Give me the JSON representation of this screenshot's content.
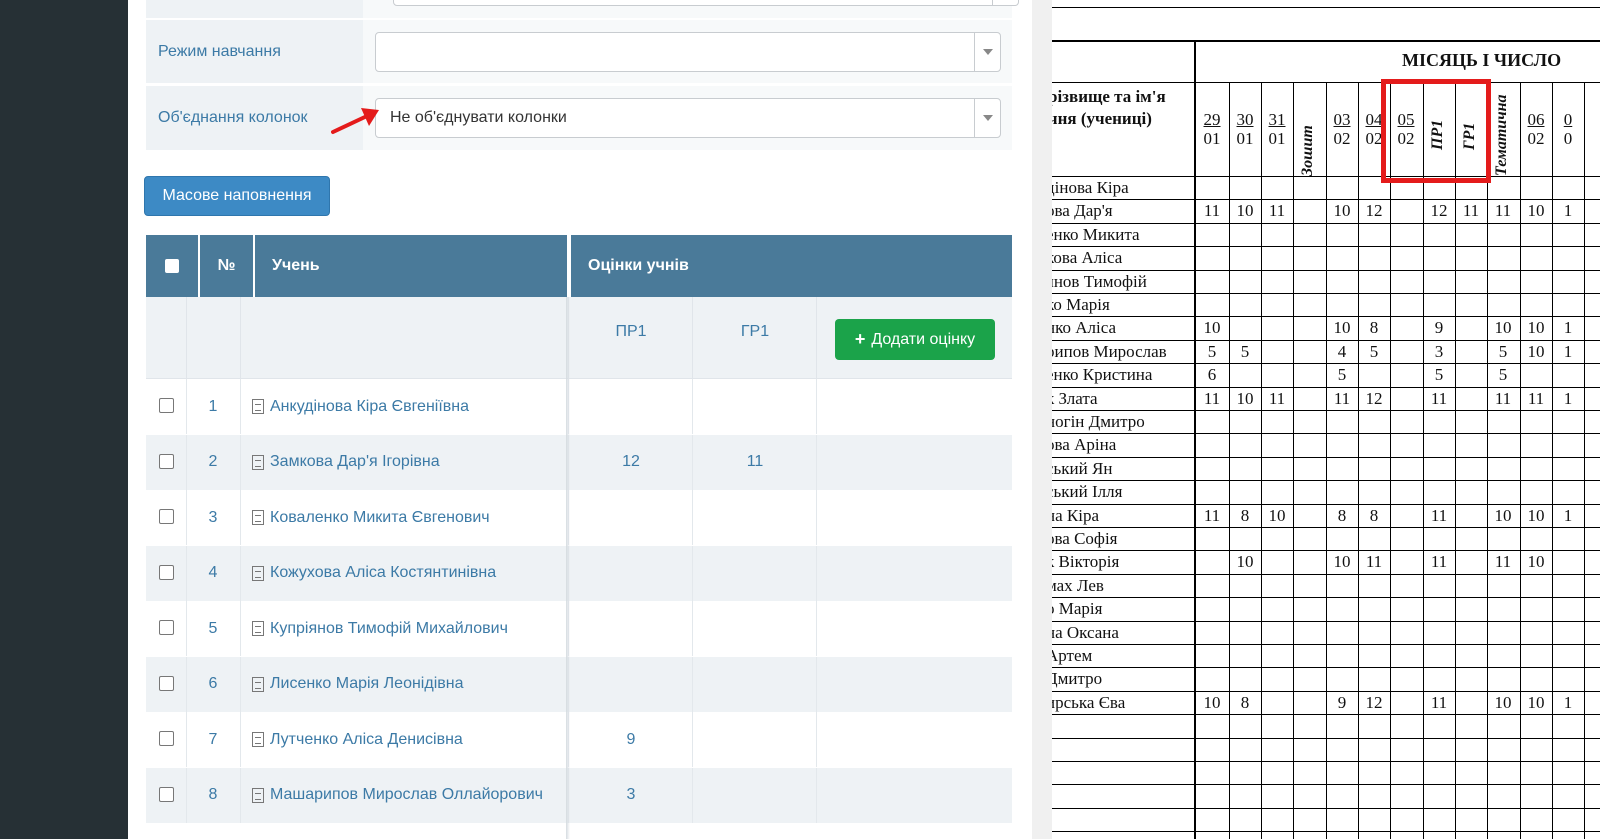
{
  "form": {
    "rows": [
      {
        "label": "Режим навчання",
        "value": ""
      },
      {
        "label": "Об'єднання колонок",
        "value": "Не об'єднувати колонки"
      }
    ],
    "mass_fill_label": "Масове наповнення"
  },
  "table": {
    "headers": {
      "num": "№",
      "student": "Учень",
      "grades": "Оцінки учнів"
    },
    "grade_columns": [
      "ПР1",
      "ГР1"
    ],
    "add_grade_label": "Додати оцінку",
    "rows": [
      {
        "n": "1",
        "name": "Анкудінова Кіра Євгеніївна",
        "pr1": "",
        "gr1": ""
      },
      {
        "n": "2",
        "name": "Замкова Дар'я Ігорівна",
        "pr1": "12",
        "gr1": "11"
      },
      {
        "n": "3",
        "name": "Коваленко Микита Євгенович",
        "pr1": "",
        "gr1": ""
      },
      {
        "n": "4",
        "name": "Кожухова Аліса Костянтинівна",
        "pr1": "",
        "gr1": ""
      },
      {
        "n": "5",
        "name": "Купріянов Тимофій Михайлович",
        "pr1": "",
        "gr1": ""
      },
      {
        "n": "6",
        "name": "Лисенко Марія Леонідівна",
        "pr1": "",
        "gr1": ""
      },
      {
        "n": "7",
        "name": "Лутченко Аліса Денисівна",
        "pr1": "9",
        "gr1": ""
      },
      {
        "n": "8",
        "name": "Машарипов Мирослав Оллайорович",
        "pr1": "3",
        "gr1": ""
      }
    ]
  },
  "journal": {
    "month_title": "МІСЯЦЬ І ЧИСЛО",
    "surname_header": "різвище та ім'я\nчня (учениці)",
    "columns": [
      {
        "type": "date",
        "d": "29",
        "m": "01"
      },
      {
        "type": "date",
        "d": "30",
        "m": "01"
      },
      {
        "type": "date",
        "d": "31",
        "m": "01"
      },
      {
        "type": "vert",
        "t": "Зошит"
      },
      {
        "type": "date",
        "d": "03",
        "m": "02"
      },
      {
        "type": "date",
        "d": "04",
        "m": "02"
      },
      {
        "type": "date",
        "d": "05",
        "m": "02"
      },
      {
        "type": "vert",
        "t": "ПР1"
      },
      {
        "type": "vert",
        "t": "ГР1"
      },
      {
        "type": "vert",
        "t": "Тематична"
      },
      {
        "type": "date",
        "d": "06",
        "m": "02"
      },
      {
        "type": "date",
        "d": "0",
        "m": "0"
      }
    ],
    "students": [
      {
        "name": "дінова Кіра",
        "g": [
          "",
          "",
          "",
          "",
          "",
          "",
          "",
          "",
          "",
          "",
          "",
          ""
        ]
      },
      {
        "name": "ова Дар'я",
        "g": [
          "11",
          "10",
          "11",
          "",
          "10",
          "12",
          "",
          "12",
          "11",
          "11",
          "10",
          "1"
        ]
      },
      {
        "name": "енко Микита",
        "g": [
          "",
          "",
          "",
          "",
          "",
          "",
          "",
          "",
          "",
          "",
          "",
          ""
        ]
      },
      {
        "name": "кова Аліса",
        "g": [
          "",
          "",
          "",
          "",
          "",
          "",
          "",
          "",
          "",
          "",
          "",
          ""
        ]
      },
      {
        "name": "янов Тимофій",
        "g": [
          "",
          "",
          "",
          "",
          "",
          "",
          "",
          "",
          "",
          "",
          "",
          ""
        ]
      },
      {
        "name": "ко Марія",
        "g": [
          "",
          "",
          "",
          "",
          "",
          "",
          "",
          "",
          "",
          "",
          "",
          ""
        ]
      },
      {
        "name": "нко Аліса",
        "g": [
          "10",
          "",
          "",
          "",
          "10",
          "8",
          "",
          "9",
          "",
          "10",
          "10",
          "1"
        ]
      },
      {
        "name": "рипов Мирослав",
        "g": [
          "5",
          "5",
          "",
          "",
          "4",
          "5",
          "",
          "3",
          "",
          "5",
          "10",
          "1"
        ]
      },
      {
        "name": "енко Кристина",
        "g": [
          "6",
          "",
          "",
          "",
          "5",
          "",
          "",
          "5",
          "",
          "5",
          "",
          ""
        ]
      },
      {
        "name": "к Злата",
        "g": [
          "11",
          "10",
          "11",
          "",
          "11",
          "12",
          "",
          "11",
          "",
          "11",
          "11",
          "1"
        ]
      },
      {
        "name": "ногін Дмитро",
        "g": [
          "",
          "",
          "",
          "",
          "",
          "",
          "",
          "",
          "",
          "",
          "",
          ""
        ]
      },
      {
        "name": "ова Аріна",
        "g": [
          "",
          "",
          "",
          "",
          "",
          "",
          "",
          "",
          "",
          "",
          "",
          ""
        ]
      },
      {
        "name": "ський Ян",
        "g": [
          "",
          "",
          "",
          "",
          "",
          "",
          "",
          "",
          "",
          "",
          "",
          ""
        ]
      },
      {
        "name": "ський Ілля",
        "g": [
          "",
          "",
          "",
          "",
          "",
          "",
          "",
          "",
          "",
          "",
          "",
          ""
        ]
      },
      {
        "name": "на Кіра",
        "g": [
          "11",
          "8",
          "10",
          "",
          "8",
          "8",
          "",
          "11",
          "",
          "10",
          "10",
          "1"
        ]
      },
      {
        "name": "ова Софія",
        "g": [
          "",
          "",
          "",
          "",
          "",
          "",
          "",
          "",
          "",
          "",
          "",
          ""
        ]
      },
      {
        "name": "к Вікторія",
        "g": [
          "",
          "10",
          "",
          "",
          "10",
          "11",
          "",
          "11",
          "",
          "11",
          "10",
          ""
        ]
      },
      {
        "name": "мах Лев",
        "g": [
          "",
          "",
          "",
          "",
          "",
          "",
          "",
          "",
          "",
          "",
          "",
          ""
        ]
      },
      {
        "name": "о Марія",
        "g": [
          "",
          "",
          "",
          "",
          "",
          "",
          "",
          "",
          "",
          "",
          "",
          ""
        ]
      },
      {
        "name": "на Оксана",
        "g": [
          "",
          "",
          "",
          "",
          "",
          "",
          "",
          "",
          "",
          "",
          "",
          ""
        ]
      },
      {
        "name": " Артем",
        "g": [
          "",
          "",
          "",
          "",
          "",
          "",
          "",
          "",
          "",
          "",
          "",
          ""
        ]
      },
      {
        "name": " Дмитро",
        "g": [
          "",
          "",
          "",
          "",
          "",
          "",
          "",
          "",
          "",
          "",
          "",
          ""
        ]
      },
      {
        "name": "ирська Єва",
        "g": [
          "10",
          "8",
          "",
          "",
          "9",
          "12",
          "",
          "11",
          "",
          "10",
          "10",
          "1"
        ]
      }
    ]
  },
  "colors": {
    "sidebar": "#263035",
    "header": "#4a7a99",
    "link": "#3c7aa6",
    "primary_button": "#3d8ac5",
    "success_button": "#1ba34a",
    "highlight": "#e41b1b"
  }
}
